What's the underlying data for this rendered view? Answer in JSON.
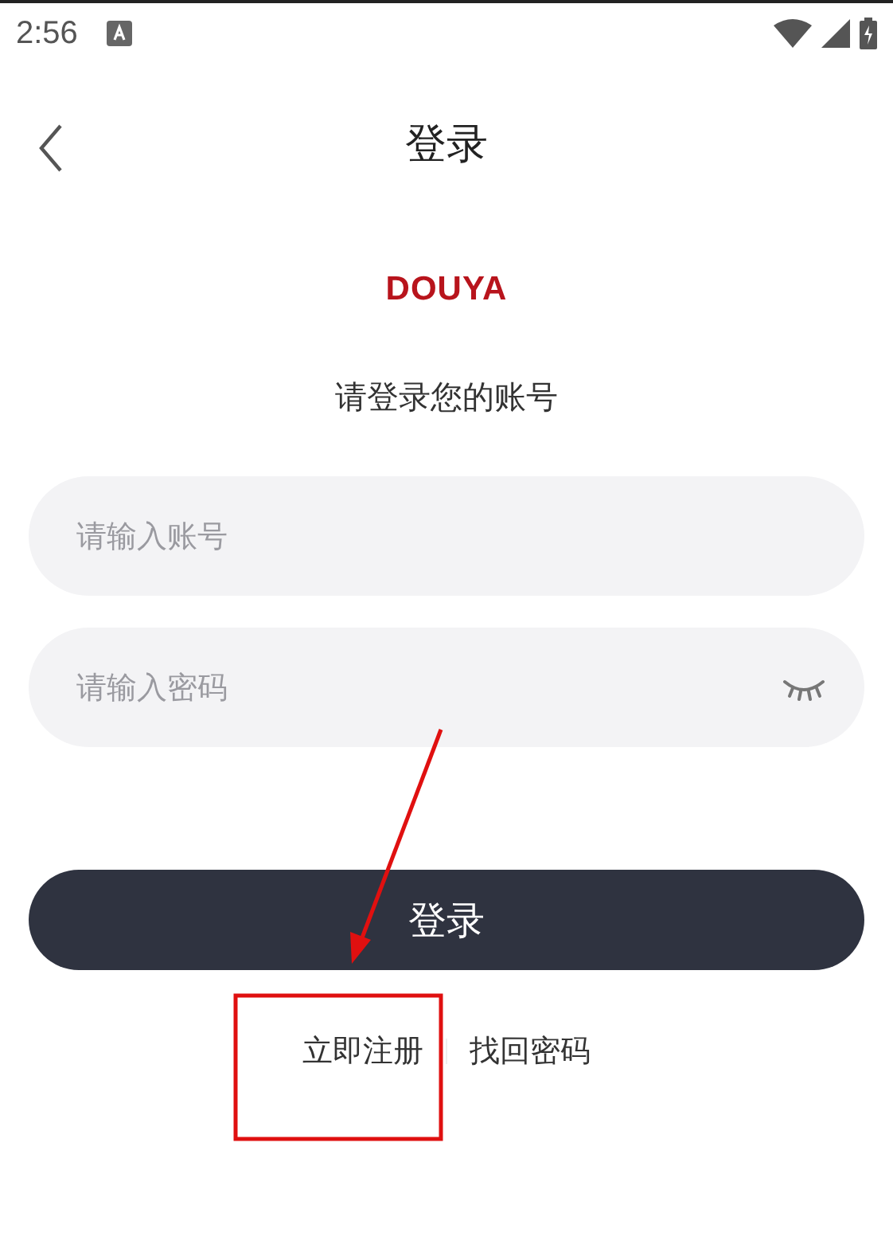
{
  "status_bar": {
    "time": "2:56"
  },
  "header": {
    "title": "登录"
  },
  "logo": {
    "text": "DOUYA"
  },
  "subtitle": "请登录您的账号",
  "fields": [
    {
      "placeholder": "请输入账号",
      "kind": "text"
    },
    {
      "placeholder": "请输入密码",
      "kind": "password"
    }
  ],
  "login_button": "登录",
  "links": [
    "立即注册",
    "找回密码"
  ],
  "annotation": {
    "kind": "arrow-and-box"
  }
}
